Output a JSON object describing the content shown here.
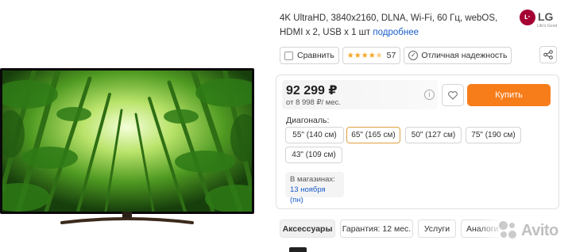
{
  "product": {
    "description": "4K UltraHD, 3840x2160, DLNA, Wi-Fi, 60 Гц, webOS, HDMI x 2, USB x 1 шт",
    "more_link": "подробнее",
    "brand": "LG",
    "brand_slogan": "Life's Good"
  },
  "chips": {
    "compare": "Сравнить",
    "rating": 4.5,
    "reviews_count": "57",
    "reliability": "Отличная надежность"
  },
  "price": {
    "value": "92 299 ₽",
    "credit": "от 8 998 ₽/ мес.",
    "buy_label": "Купить"
  },
  "diagonal": {
    "label": "Диагональ:",
    "options": [
      "55\" (140 см)",
      "65\" (165 см)",
      "50\" (127 см)",
      "75\" (190 см)",
      "43\" (109 см)"
    ],
    "selected": "65\" (165 см)"
  },
  "availability": {
    "title": "В магазинах:",
    "date": "13 ноября (пн)"
  },
  "tabs": [
    "Аксессуары",
    "Гарантия: 12 мес.",
    "Услуги",
    "Аналоги"
  ],
  "watermark": "Avito",
  "colors": {
    "accent": "#f77d1b",
    "link": "#1a5cc9",
    "brand": "#a50034",
    "selected_border": "#e0a040",
    "star": "#f5a623"
  }
}
